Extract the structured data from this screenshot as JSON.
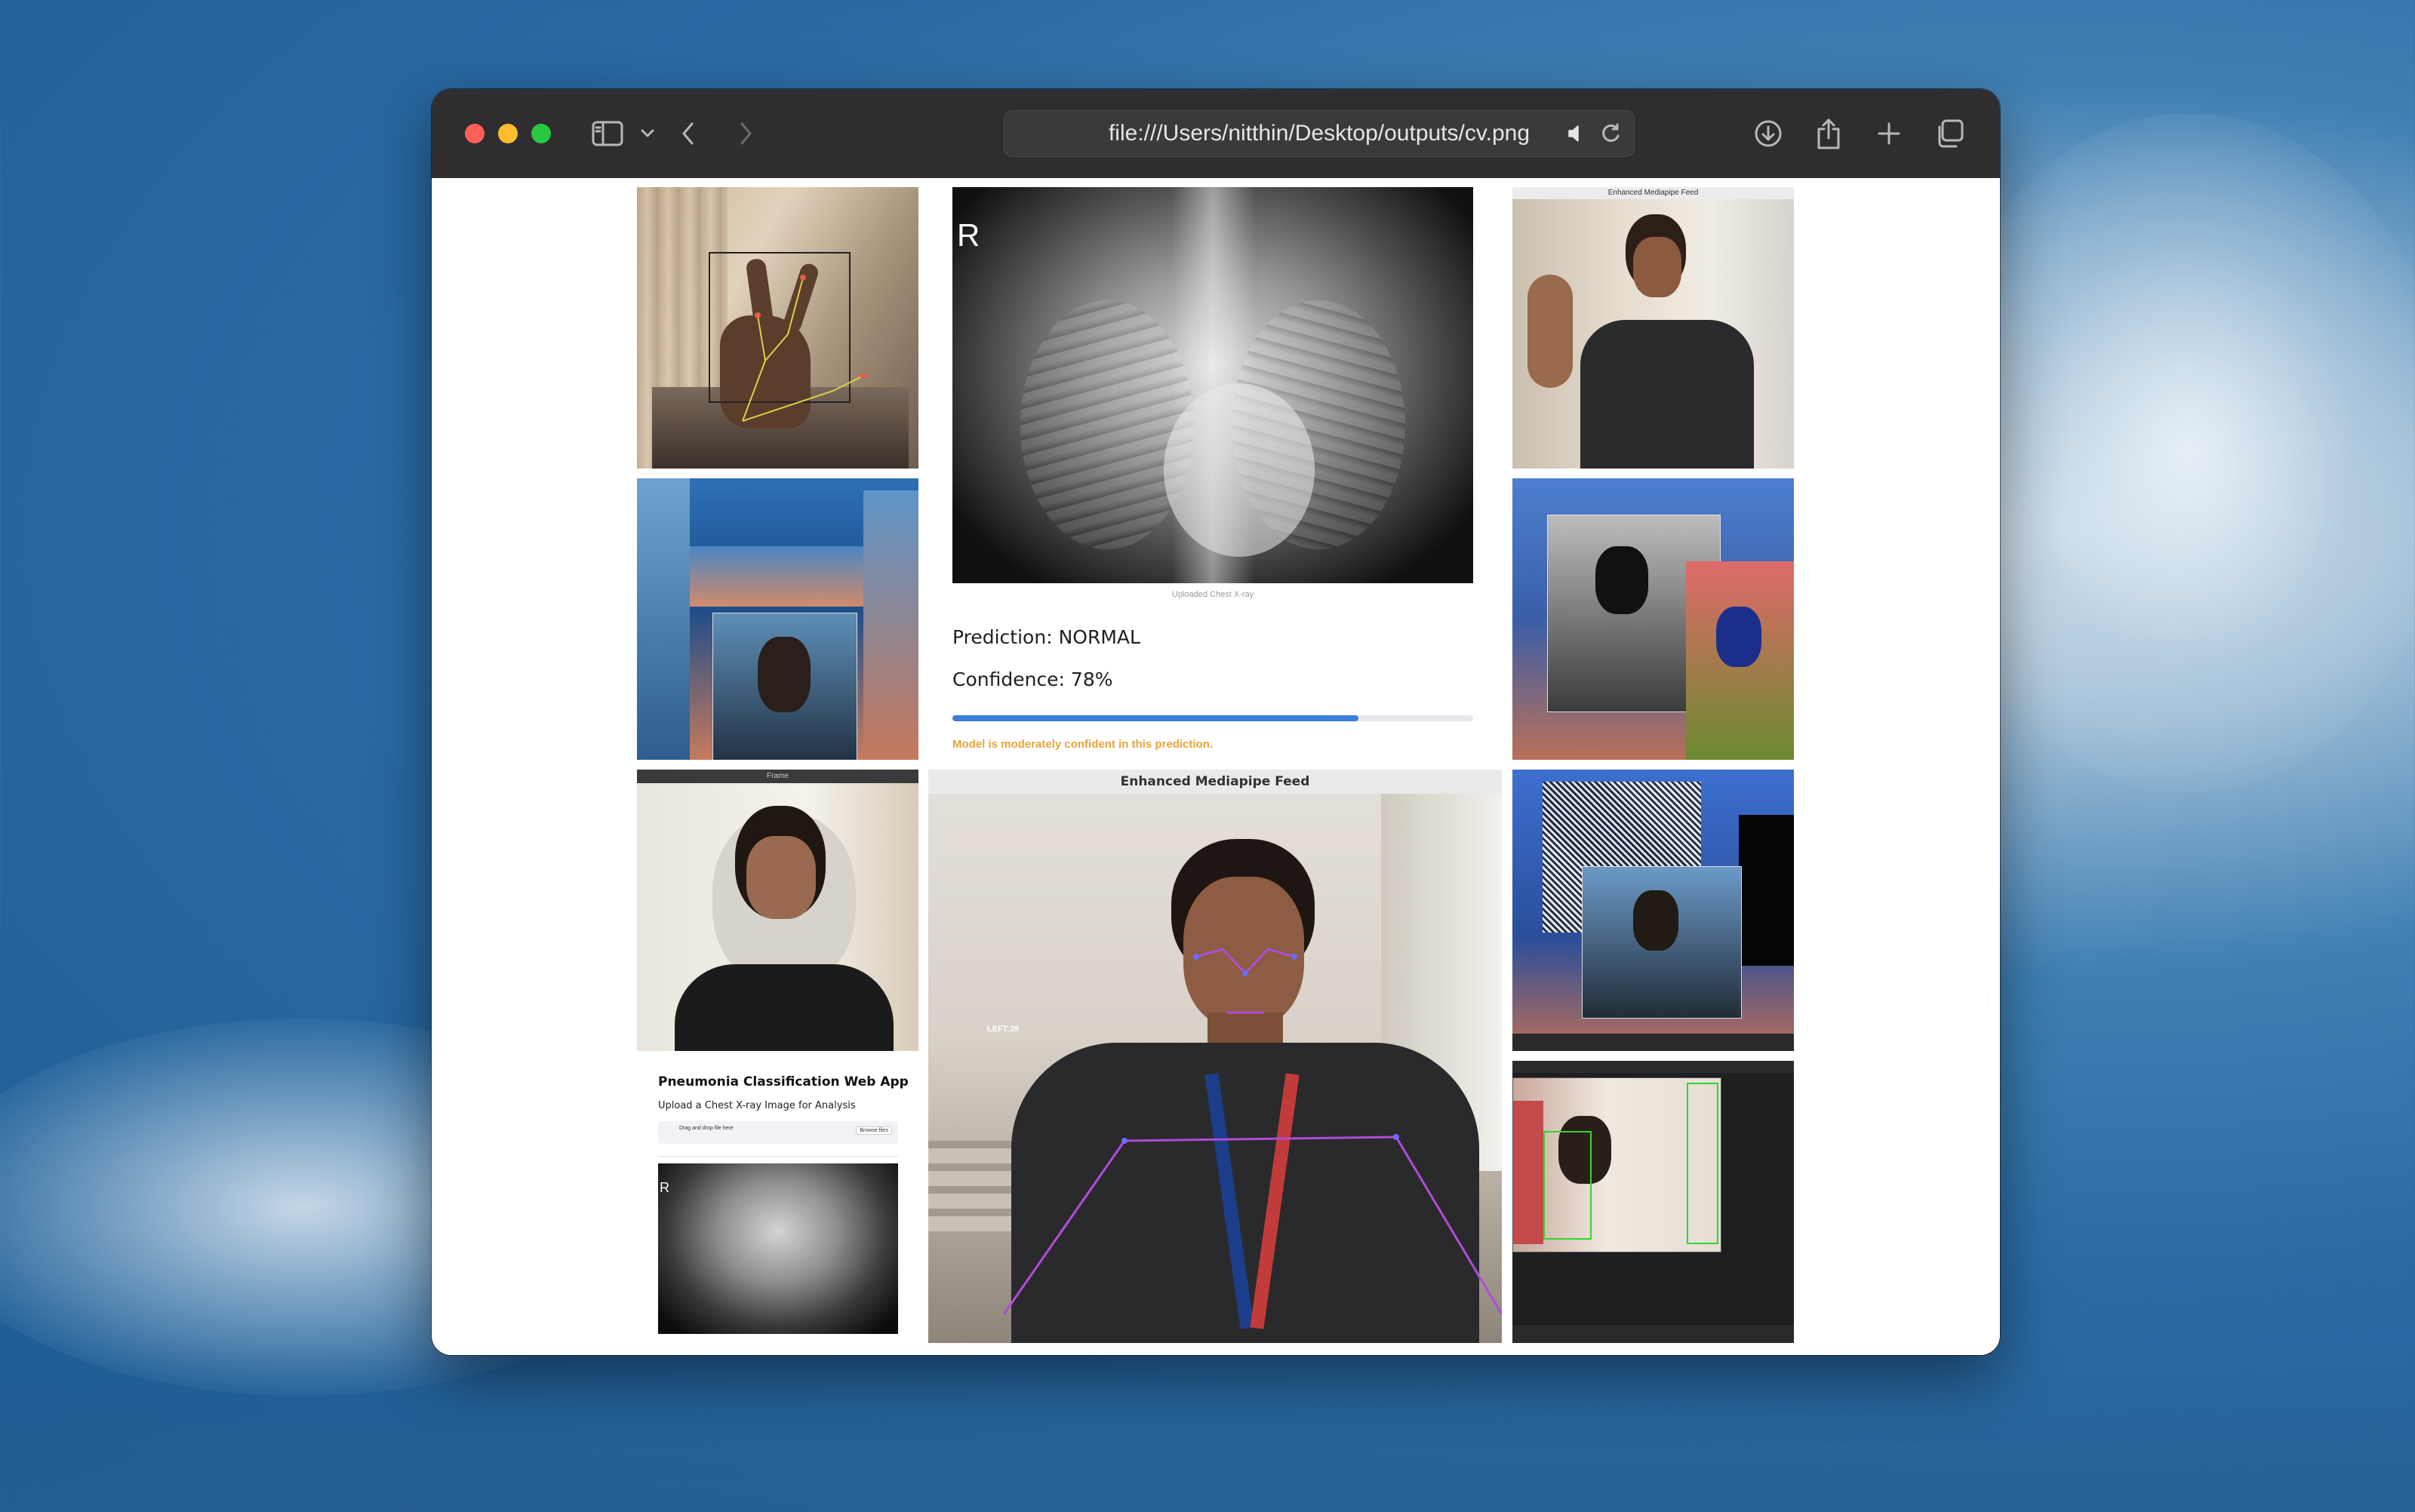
{
  "browser": {
    "url": "file:///Users/nitthin/Desktop/outputs/cv.png"
  },
  "colors": {
    "close": "#fe5f57",
    "minimize": "#febc2e",
    "zoom": "#28c840",
    "progress": "#3b7fd9",
    "warning": "#e8a33a"
  },
  "xray_panel": {
    "marker": "R",
    "caption": "Uploaded Chest X-ray",
    "prediction": "Prediction: NORMAL",
    "confidence": "Confidence: 78%",
    "confidence_value": 0.78,
    "note": "Model is moderately confident in this prediction."
  },
  "feed_main": {
    "title": "Enhanced Mediapipe Feed",
    "overlay_text": "LEFT:28"
  },
  "feed_small": {
    "title": "Enhanced Mediapipe Feed"
  },
  "frame_tile": {
    "title": "Frame"
  },
  "webapp_tile": {
    "title": "Pneumonia Classification Web App",
    "subtitle": "Upload a Chest X-ray Image for Analysis",
    "dropzone": "Drag and drop file here",
    "browse": "Browse files",
    "marker": "R"
  },
  "icons": [
    "sidebar-icon",
    "chevron-down-icon",
    "back-icon",
    "forward-icon",
    "grammarly-icon",
    "shield-icon",
    "reader-icon",
    "speaker-icon",
    "reload-icon",
    "download-icon",
    "share-icon",
    "plus-icon",
    "tabs-icon"
  ]
}
